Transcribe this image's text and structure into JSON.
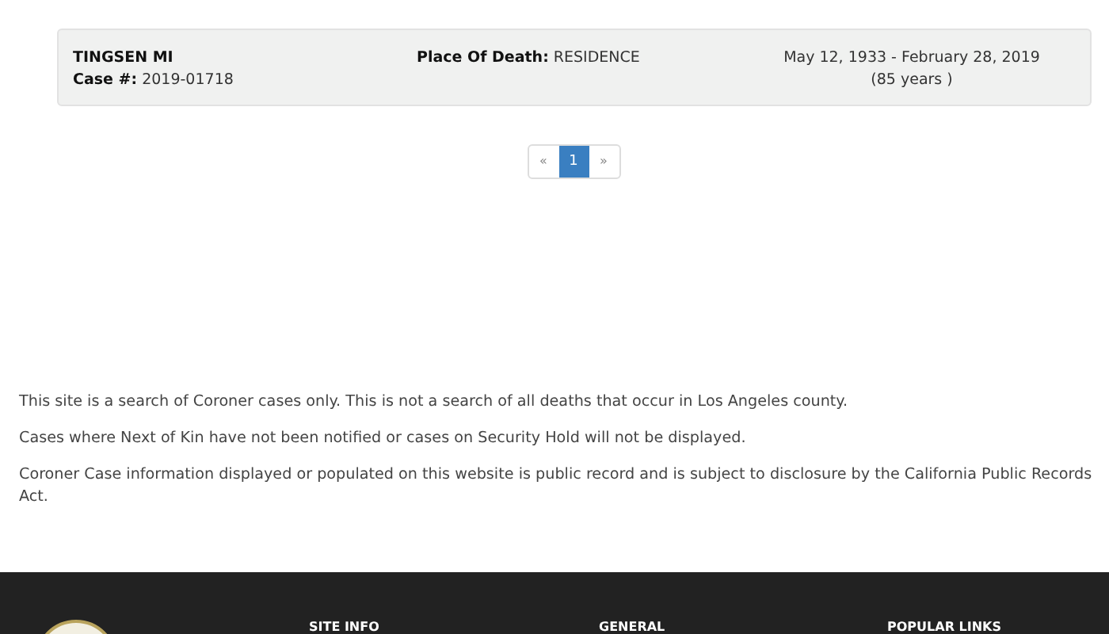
{
  "case_card": {
    "name": "TINGSEN MI",
    "case_label": "Case #:",
    "case_number": "2019-01718",
    "place_label": "Place Of Death:",
    "place": "RESIDENCE",
    "dates": "May 12, 1933 - February 28, 2019",
    "age": "(85 years )"
  },
  "pagination": {
    "prev": "«",
    "pages": [
      {
        "label": "1",
        "selected": true
      }
    ],
    "next": "»"
  },
  "notices": [
    "This site is a search of Coroner cases only. This is not a search of all deaths that occur in Los Angeles county.",
    "Cases where Next of Kin have not been notified or cases on Security Hold will not be displayed.",
    "Coroner Case information displayed or populated on this website is public record and is subject to disclosure by the California Public Records Act."
  ],
  "footer": {
    "headings": [
      "SITE INFO",
      "GENERAL",
      "POPULAR LINKS"
    ]
  }
}
